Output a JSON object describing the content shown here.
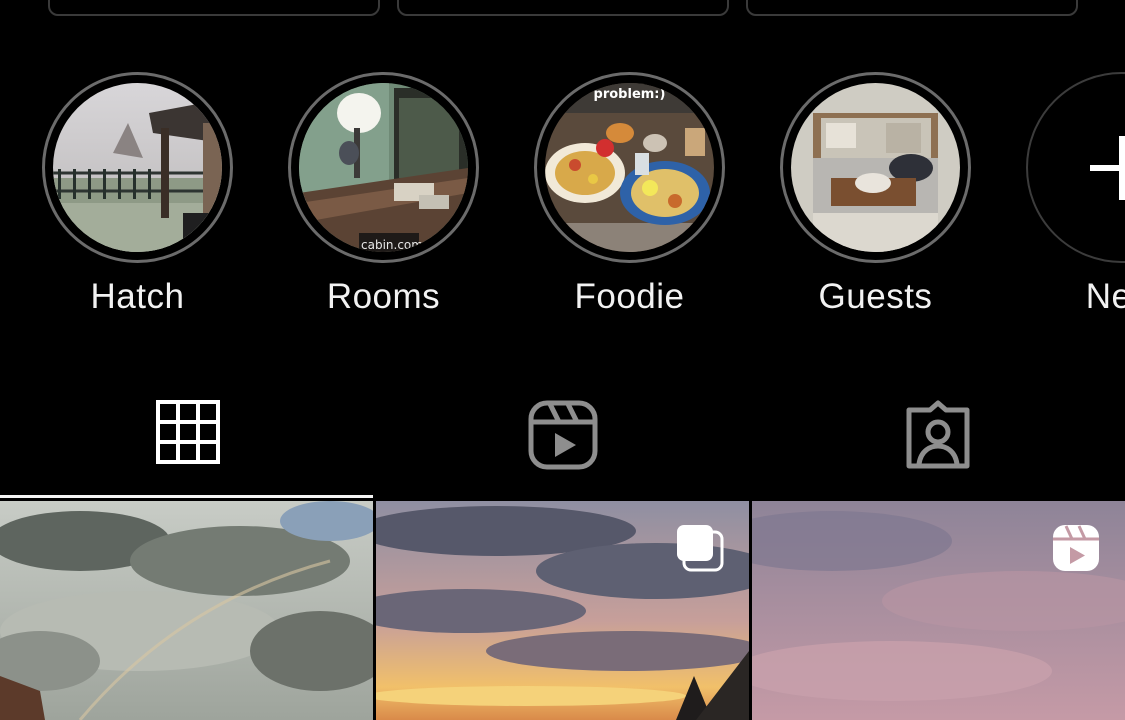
{
  "highlights": [
    {
      "label": "Hatch",
      "image": "snowy-yard-photo"
    },
    {
      "label": "Rooms",
      "image": "room-desk-photo"
    },
    {
      "label": "Foodie",
      "image": "food-plates-photo",
      "overlay_text": "problem:)"
    },
    {
      "label": "Guests",
      "image": "bed-tray-photo"
    },
    {
      "label": "New",
      "image": "plus-icon"
    }
  ],
  "tabs": [
    {
      "name": "posts-grid",
      "icon": "grid-icon",
      "active": true
    },
    {
      "name": "reels",
      "icon": "reels-icon",
      "active": false
    },
    {
      "name": "tagged",
      "icon": "tagged-person-icon",
      "active": false
    }
  ],
  "posts": [
    {
      "image": "cloudy-sky-rainbow-photo",
      "badge": ""
    },
    {
      "image": "sunset-clouds-photo",
      "badge": "carousel-icon"
    },
    {
      "image": "pink-sky-photo",
      "badge": "reels-icon"
    }
  ],
  "colors": {
    "background": "#000000",
    "text": "#f2f2f2",
    "ring": "#6b6b6b",
    "icon_inactive": "#8e8e8e",
    "icon_active": "#ffffff"
  }
}
